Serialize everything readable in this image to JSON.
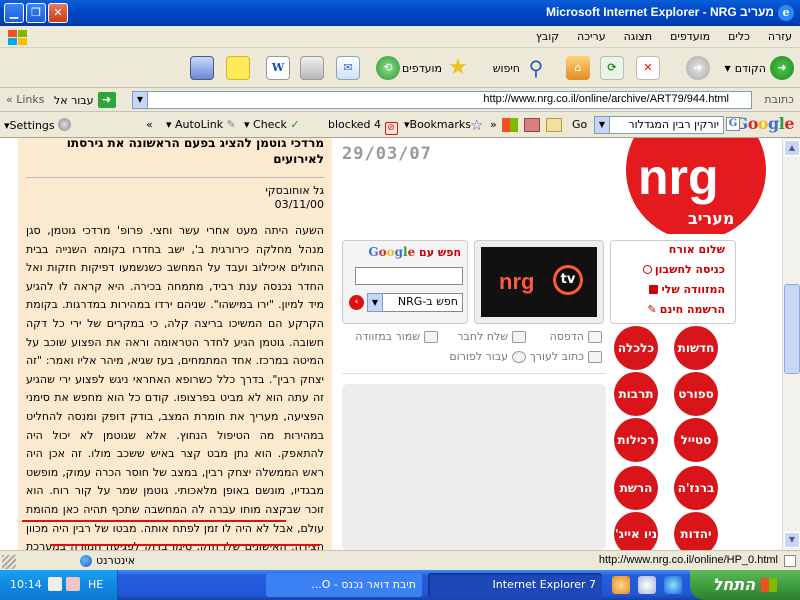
{
  "window": {
    "title": "Microsoft Internet Explorer - NRG מעריב"
  },
  "menu": [
    "קובץ",
    "עריכה",
    "תצוגה",
    "מועדפים",
    "כלים",
    "עזרה"
  ],
  "toolbar": {
    "forward_label": "הקודם",
    "search_label": "חיפוש",
    "favorites_label": "מועדפים"
  },
  "address": {
    "label": "כתובת",
    "url": "http://www.nrg.co.il/online/archive/ART79/944.html",
    "go_label": "עבור אל",
    "links_label": "Links"
  },
  "googlebar": {
    "logo": "Google",
    "go_label": "Go",
    "search_value": "יורקין רבין המגדלור",
    "bookmarks_label": "Bookmarks",
    "blocked_label": "blocked 4",
    "check_label": "Check",
    "autolink_label": "AutoLink",
    "settings_label": "Settings"
  },
  "article": {
    "title": "מרדכי גוטמן להציג בפעם הראשונה את גירסתו לאירועים",
    "author": "גל אוחובסקי",
    "date": "03/11/00",
    "body": "השעה היתה מעט אחרי עשר וחצי. פרופ' מרדכי גוטמן, סגן מנהל מחלקה כירורגית ב', ישב בחדרו בקומה השנייה בבית החולים איכילוב ועבד על המחשב כשנשמעו דפיקות חזקות ואל החדר נכנסה ענת רביד, מתמחה בכירה. היא קראה לו להגיע מיד למיון. \"ירו במישהו\". שניהם ירדו במהירות במדרגות. בקומת הקרקע הם המשיכו בריצה קלה, כי במקרים של ירי כל דקה חשובה. גוטמן הגיע לחדר הטראומה וראה את הפצוע שוכב על המיטה במרכז. אחד המתמחים, בעז שגיא, מיהר אליו ואמר: \"זה יצחק רבין\". בדרך כלל כשרופא האחראי ניגש לפצוע ירי שהגיע זה עתה הוא לא מביט בפרצופו. קודם כל הוא מחפש את סימני הפציעה, מעריך את חומרת המצב, בודק דופק ומנסה להחליט במהירות מה הטיפול הנחוץ. אלא שגוטמן לא יכול היה להתאפק. הוא נתן מבט קצר באיש ששכב מולו. זה אכן היה ראש הממשלה יצחק רבין, במצב של חוסר הכרה עמוק, מופשט מבגדיו, מונשם באופן מלאכותי. גוטמן שמר על קור רוח. הוא זוכר שבקצה מוחו עברה לה המחשבה שתכף תהיה כאן מהומת עולם, אבל לא היה לו זמן לפתח אותה. מבטו של רבין היה מכוון הצידה. האישונים שלו חזק. סימן בדוק לפגיעה חמורה במערכת העצבים. גוטמ | בדק"
  },
  "site": {
    "date": "29/03/07",
    "logo_text": "nrg",
    "logo_sub": "מעריב",
    "search_title": "חפש עם",
    "search_google": "Google",
    "search_select": "חפש ב-NRG",
    "tv_text": "nrg",
    "tv_circle": "tv",
    "user_greeting": "שלום אורח",
    "user_login": "כניסה לחשבון",
    "user_mail": "המזוודה שלי",
    "user_register": "הרשמה חינם",
    "act_print": "הדפסה",
    "act_send": "שלח לחבר",
    "act_save": "שמור במזוודה",
    "act_editor": "כתוב לעורך",
    "act_forum": "עבור לפורום",
    "categories": [
      "חדשות",
      "כלכלה",
      "ספורט",
      "תרבות",
      "סטייל",
      "רכילות",
      "ברנז'ה",
      "הרשת",
      "יהדות",
      "ניו אייג'"
    ]
  },
  "status": {
    "url": "http://www.nrg.co.il/online/HP_0.html",
    "zone": "אינטרנט"
  },
  "taskbar": {
    "start_label": "התחל",
    "task1": "Internet Explorer 7",
    "task2": "תיבת דואר נכנס - O...",
    "lang": "HE",
    "clock": "10:14"
  }
}
